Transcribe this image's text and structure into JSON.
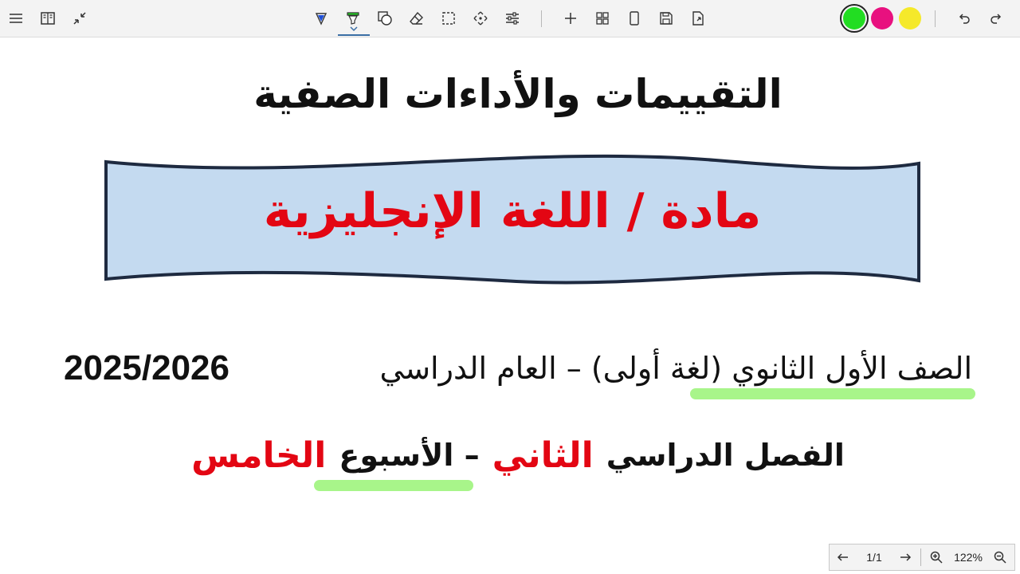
{
  "toolbar": {
    "tools": [
      {
        "name": "menu-icon"
      },
      {
        "name": "book-icon"
      },
      {
        "name": "collapse-icon"
      },
      {
        "name": "pen-icon"
      },
      {
        "name": "highlighter-icon"
      },
      {
        "name": "shapes-icon"
      },
      {
        "name": "eraser-icon"
      },
      {
        "name": "lasso-select-icon"
      },
      {
        "name": "move-icon"
      },
      {
        "name": "settings-sliders-icon"
      },
      {
        "name": "add-icon"
      },
      {
        "name": "grid-icon"
      },
      {
        "name": "page-icon"
      },
      {
        "name": "save-icon"
      },
      {
        "name": "export-icon"
      },
      {
        "name": "undo-icon"
      },
      {
        "name": "redo-icon"
      }
    ],
    "colors": [
      "#22dd22",
      "#e8117f",
      "#f5e92a"
    ],
    "selected_color": "#22dd22"
  },
  "document": {
    "title": "التقييمات والأداءات الصفية",
    "subject": "مادة / اللغة الإنجليزية",
    "grade_line": "الصف الأول الثانوي (لغة أولى)  – العام الدراسي",
    "year": "2025/2026",
    "term_prefix": "الفصل الدراسي",
    "term_name": "الثاني",
    "week_prefix": "– الأسبوع",
    "week_name": "الخامس"
  },
  "navigation": {
    "page_indicator": "1/1",
    "zoom": "122%"
  }
}
